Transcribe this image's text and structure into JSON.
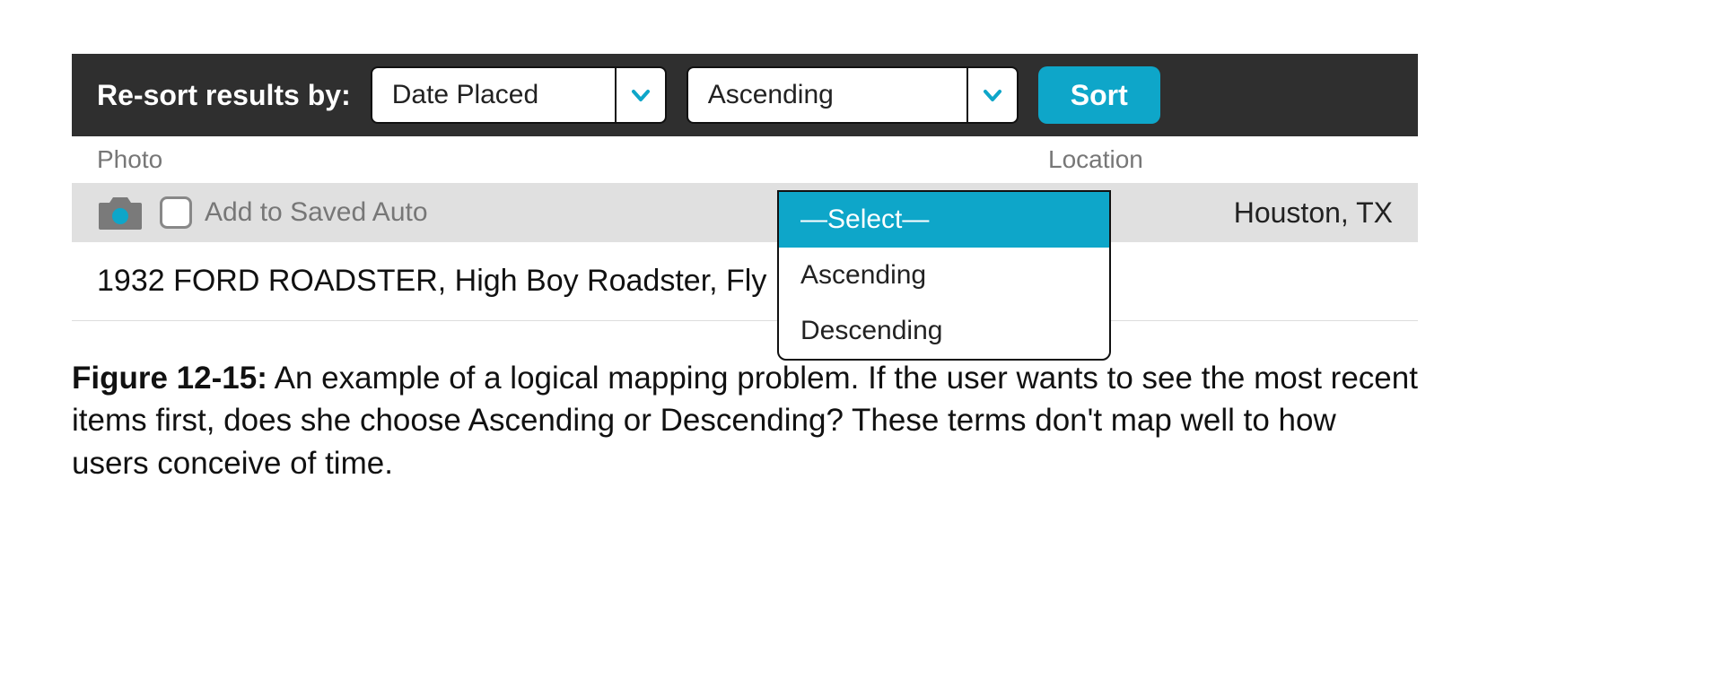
{
  "sortbar": {
    "label": "Re-sort results by:",
    "field_select": {
      "value": "Date Placed"
    },
    "order_select": {
      "value": "Ascending"
    },
    "button": "Sort"
  },
  "dropdown": {
    "options": [
      {
        "label": "—Select—",
        "selected": true
      },
      {
        "label": "Ascending",
        "selected": false
      },
      {
        "label": "Descending",
        "selected": false
      }
    ]
  },
  "columns": {
    "photo": "Photo",
    "location": "Location"
  },
  "listing": {
    "save_label": "Add to Saved Auto",
    "location": "Houston, TX",
    "description": "1932 FORD ROADSTER, High Boy Roadster, Fly"
  },
  "caption": {
    "label": "Figure 12-15:",
    "text": " An example of a logical mapping problem. If the user wants to see the most recent items first, does she choose Ascending or Descending? These terms don't map well to how users conceive of time."
  },
  "colors": {
    "accent": "#0ea6c9",
    "bar": "#2f2f2f"
  }
}
